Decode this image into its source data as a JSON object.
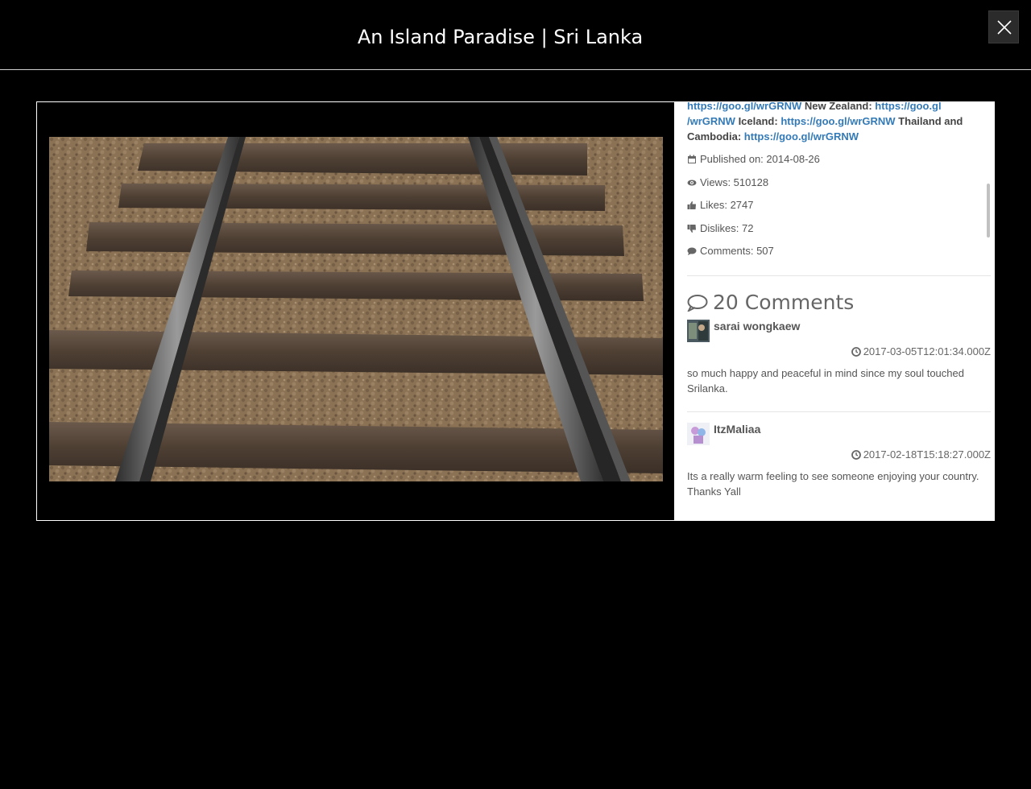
{
  "modal": {
    "title": "An Island Paradise | Sri Lanka",
    "close_label": "×"
  },
  "description": {
    "line1_text1": "https://goo.gl/wrGRNW",
    "line1_text2": " New Zealand: ",
    "line1_link2": "https://goo.gl",
    "line2_link1": "/wrGRNW",
    "line2_text1": " Iceland: ",
    "line2_link2": "https://goo.gl/wrGRNW",
    "line2_text2": " Thailand and",
    "line3_text1": "Cambodia: ",
    "line3_link1": "https://goo.gl/wrGRNW"
  },
  "stats": {
    "published": "Published on: 2014-08-26",
    "views": "Views: 510128",
    "likes": "Likes: 2747",
    "dislikes": "Dislikes: 72",
    "comments": "Comments: 507"
  },
  "comments_heading": "20 Comments",
  "comments": [
    {
      "author": "sarai wongkaew",
      "time": "2017-03-05T12:01:34.000Z",
      "text": "so much happy and peaceful in mind since my soul touched Srilanka."
    },
    {
      "author": "ItzMaliaa",
      "time": "2017-02-18T15:18:27.000Z",
      "text": "Its a really warm feeling to see someone enjoying your country. Thanks Yall"
    }
  ],
  "colors": {
    "link": "#337ab7",
    "background": "#000000",
    "panel": "#ffffff"
  },
  "icons": [
    "close-icon",
    "calendar-icon",
    "eye-icon",
    "thumbs-up-icon",
    "thumbs-down-icon",
    "comment-icon",
    "clock-icon"
  ]
}
